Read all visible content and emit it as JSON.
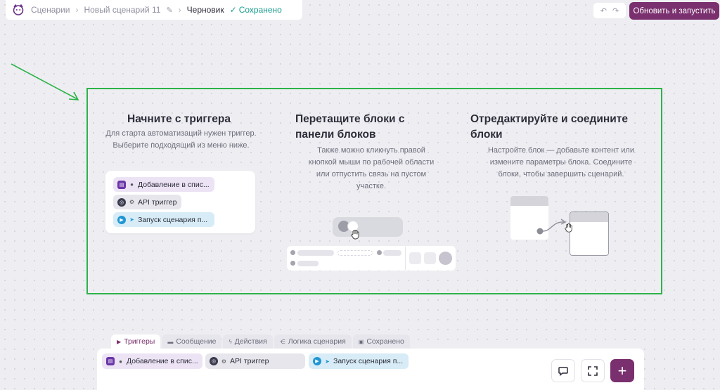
{
  "colors": {
    "accent": "#7a2f6e",
    "saved": "#1a9e8f",
    "highlight": "#2db34a"
  },
  "topbar": {
    "logo_icon": "mascot-logo-icon",
    "breadcrumbs": [
      "Сценарии",
      "Новый сценарий 11"
    ],
    "status": "Черновик",
    "saved_label": "Сохранено",
    "undo_icon": "undo-icon",
    "redo_icon": "redo-icon",
    "primary_button": "Обновить и запустить"
  },
  "onboarding": {
    "step1": {
      "title": "Начните с триггера",
      "description_lines": [
        "Для старта автоматизаций нужен триггер.",
        "Выберите подходящий из меню ниже."
      ],
      "chips": [
        "Добавление в спис...",
        "API триггер",
        "Запуск сценария п..."
      ]
    },
    "step2": {
      "title_lines": [
        "Перетащите блоки с",
        "панели блоков"
      ],
      "description_lines": [
        "Также можно кликнуть правой",
        "кнопкой мыши по рабочей области",
        "или отпустить связь на пустом",
        "участке."
      ]
    },
    "step3": {
      "title_lines": [
        "Отредактируйте и соедините",
        "блоки"
      ],
      "description_lines": [
        "Настройте блок — добавьте контент или",
        "измените параметры блока. Соедините",
        "блоки, чтобы завершить сценарий."
      ]
    }
  },
  "bottom_panel": {
    "tabs": [
      {
        "label": "Триггеры",
        "icon": "play-icon",
        "active": true
      },
      {
        "label": "Сообщение",
        "icon": "message-icon",
        "active": false
      },
      {
        "label": "Действия",
        "icon": "lightning-icon",
        "active": false
      },
      {
        "label": "Логика сценария",
        "icon": "branch-icon",
        "active": false
      },
      {
        "label": "Сохранено",
        "icon": "saved-icon",
        "active": false
      }
    ],
    "items": [
      "Добавление в спис...",
      "API триггер",
      "Запуск сценария п..."
    ],
    "buttons": {
      "comment_icon": "comment-icon",
      "fullscreen_icon": "fullscreen-icon",
      "add_label": "+"
    }
  }
}
